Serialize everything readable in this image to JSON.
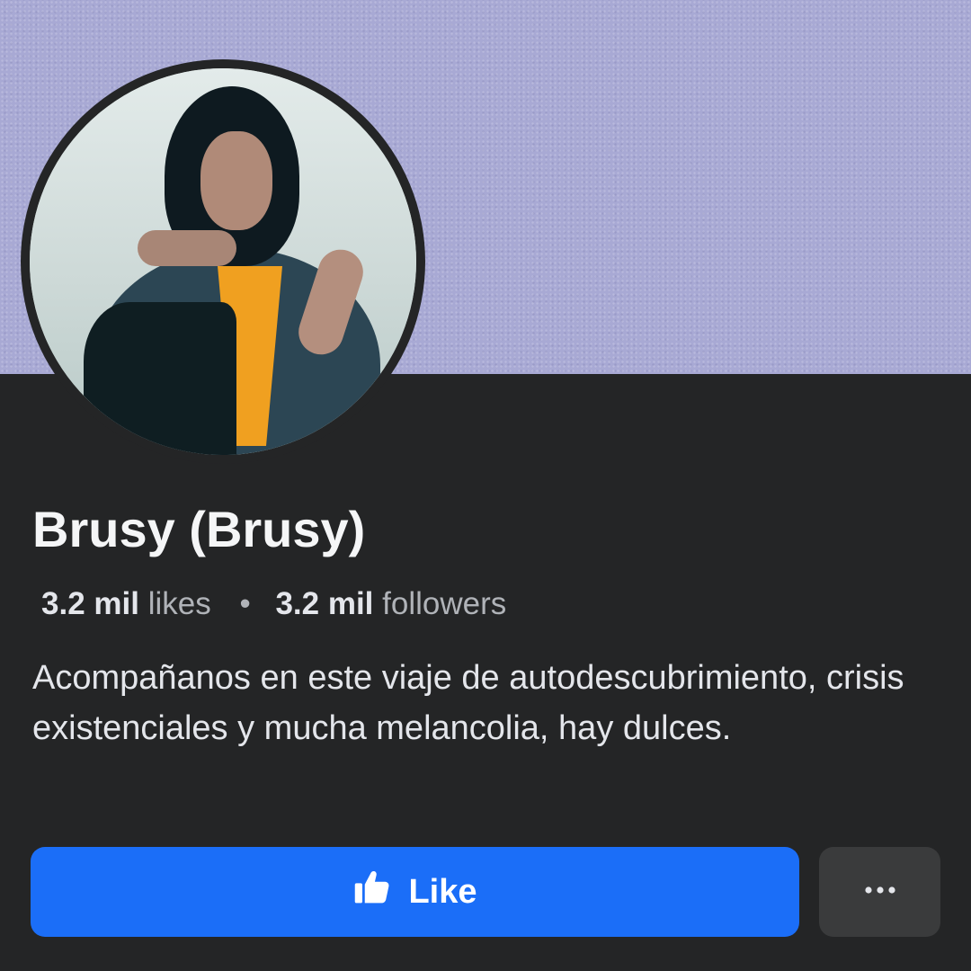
{
  "profile": {
    "name": "Brusy (Brusy)",
    "likes_count": "3.2 mil",
    "likes_label": "likes",
    "separator": "•",
    "followers_count": "3.2 mil",
    "followers_label": "followers",
    "bio": "Acompañanos en este viaje de autodescubrimiento, crisis existenciales y mucha melancolia, hay dulces."
  },
  "actions": {
    "like_label": "Like",
    "like_icon": "thumbs-up-icon",
    "more_icon": "more-options-icon"
  },
  "colors": {
    "background": "#242526",
    "cover": "#a8a9d4",
    "like_button": "#1b6ef8",
    "more_button": "#3a3b3c"
  }
}
